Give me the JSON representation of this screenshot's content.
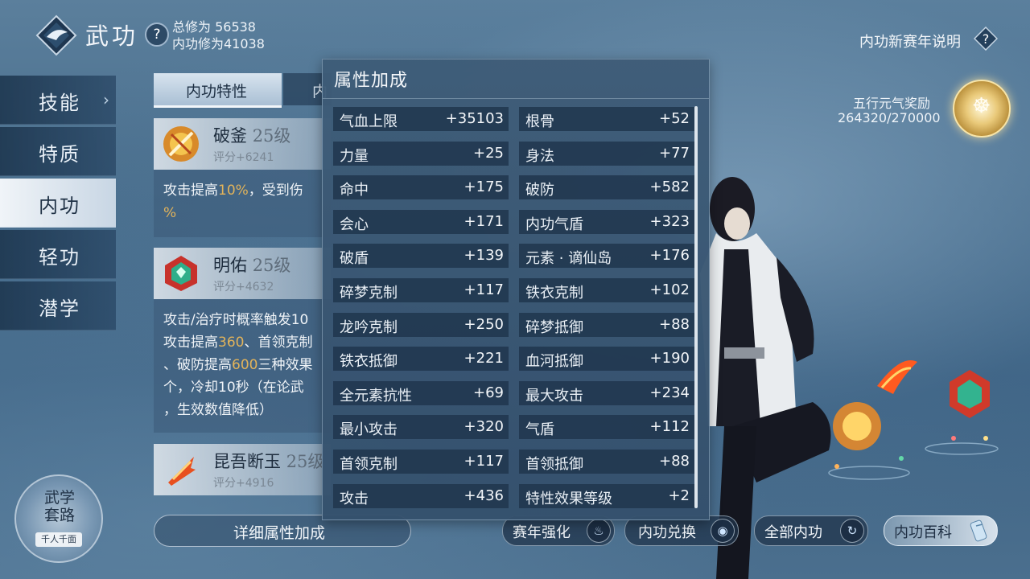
{
  "header": {
    "title": "武功",
    "help_icon": "?",
    "total_cultivation": "总修为 56538",
    "inner_cultivation": "内功修为41038"
  },
  "sidebar": {
    "items": [
      {
        "label": "技能"
      },
      {
        "label": "特质"
      },
      {
        "label": "内功"
      },
      {
        "label": "轻功"
      },
      {
        "label": "潜学"
      }
    ],
    "active": "内功"
  },
  "left_panel": {
    "tabs": [
      "内功特性",
      "内"
    ],
    "skills": [
      {
        "name": "破釜",
        "level": "25级",
        "score": "评分+6241",
        "desc_line1_a": "攻击提高",
        "desc_line1_hl": "10%",
        "desc_line1_b": "，受到伤",
        "desc_line2": "%"
      },
      {
        "name": "明佑",
        "level": "25级",
        "score": "评分+4632",
        "desc_line1": "攻击/治疗时概率触发10",
        "desc_line2_a": "攻击提高",
        "desc_line2_hl": "360",
        "desc_line2_b": "、首领克制",
        "desc_line3_a": "、破防提高",
        "desc_line3_hl": "600",
        "desc_line3_b": "三种效果",
        "desc_line4": "个，冷却10秒（在论武",
        "desc_line5": "，生效数值降低）"
      },
      {
        "name": "昆吾断玉",
        "level": "25级",
        "score": "评分+4916"
      }
    ],
    "detail_button": "详细属性加成",
    "wuxue": {
      "line1": "武学",
      "line2": "套路",
      "tag": "千人千面"
    }
  },
  "popup": {
    "title": "属性加成",
    "left_column": [
      {
        "name": "气血上限",
        "value": "+35103"
      },
      {
        "name": "力量",
        "value": "+25"
      },
      {
        "name": "命中",
        "value": "+175"
      },
      {
        "name": "会心",
        "value": "+171"
      },
      {
        "name": "破盾",
        "value": "+139"
      },
      {
        "name": "碎梦克制",
        "value": "+117"
      },
      {
        "name": "龙吟克制",
        "value": "+250"
      },
      {
        "name": "铁衣抵御",
        "value": "+221"
      },
      {
        "name": "全元素抗性",
        "value": "+69"
      },
      {
        "name": "最小攻击",
        "value": "+320"
      },
      {
        "name": "首领克制",
        "value": "+117"
      },
      {
        "name": "攻击",
        "value": "+436"
      }
    ],
    "right_column": [
      {
        "name": "根骨",
        "value": "+52"
      },
      {
        "name": "身法",
        "value": "+77"
      },
      {
        "name": "破防",
        "value": "+582"
      },
      {
        "name": "内功气盾",
        "value": "+323"
      },
      {
        "name": "元素 · 谪仙岛",
        "value": "+176"
      },
      {
        "name": "铁衣克制",
        "value": "+102"
      },
      {
        "name": "碎梦抵御",
        "value": "+88"
      },
      {
        "name": "血河抵御",
        "value": "+190"
      },
      {
        "name": "最大攻击",
        "value": "+234"
      },
      {
        "name": "气盾",
        "value": "+112"
      },
      {
        "name": "首领抵御",
        "value": "+88"
      },
      {
        "name": "特性效果等级",
        "value": "+2"
      }
    ]
  },
  "right_panel": {
    "new_season_label": "内功新赛年说明",
    "help_icon": "?",
    "reward_label": "五行元气奖励",
    "reward_value": "264320/270000",
    "medal_glyph": "☸"
  },
  "bottom_buttons": [
    {
      "label": "赛年强化",
      "icon": "flame-icon",
      "glyph": "♨"
    },
    {
      "label": "内功兑换",
      "icon": "target-icon",
      "glyph": "◉"
    },
    {
      "label": "全部内功",
      "icon": "swirl-icon",
      "glyph": "↻"
    },
    {
      "label": "内功百科",
      "icon": "scroll-icon"
    }
  ],
  "colors": {
    "highlight": "#e2b35a",
    "popup_bg": "#3e5c78",
    "row_bg": "#20364e"
  }
}
